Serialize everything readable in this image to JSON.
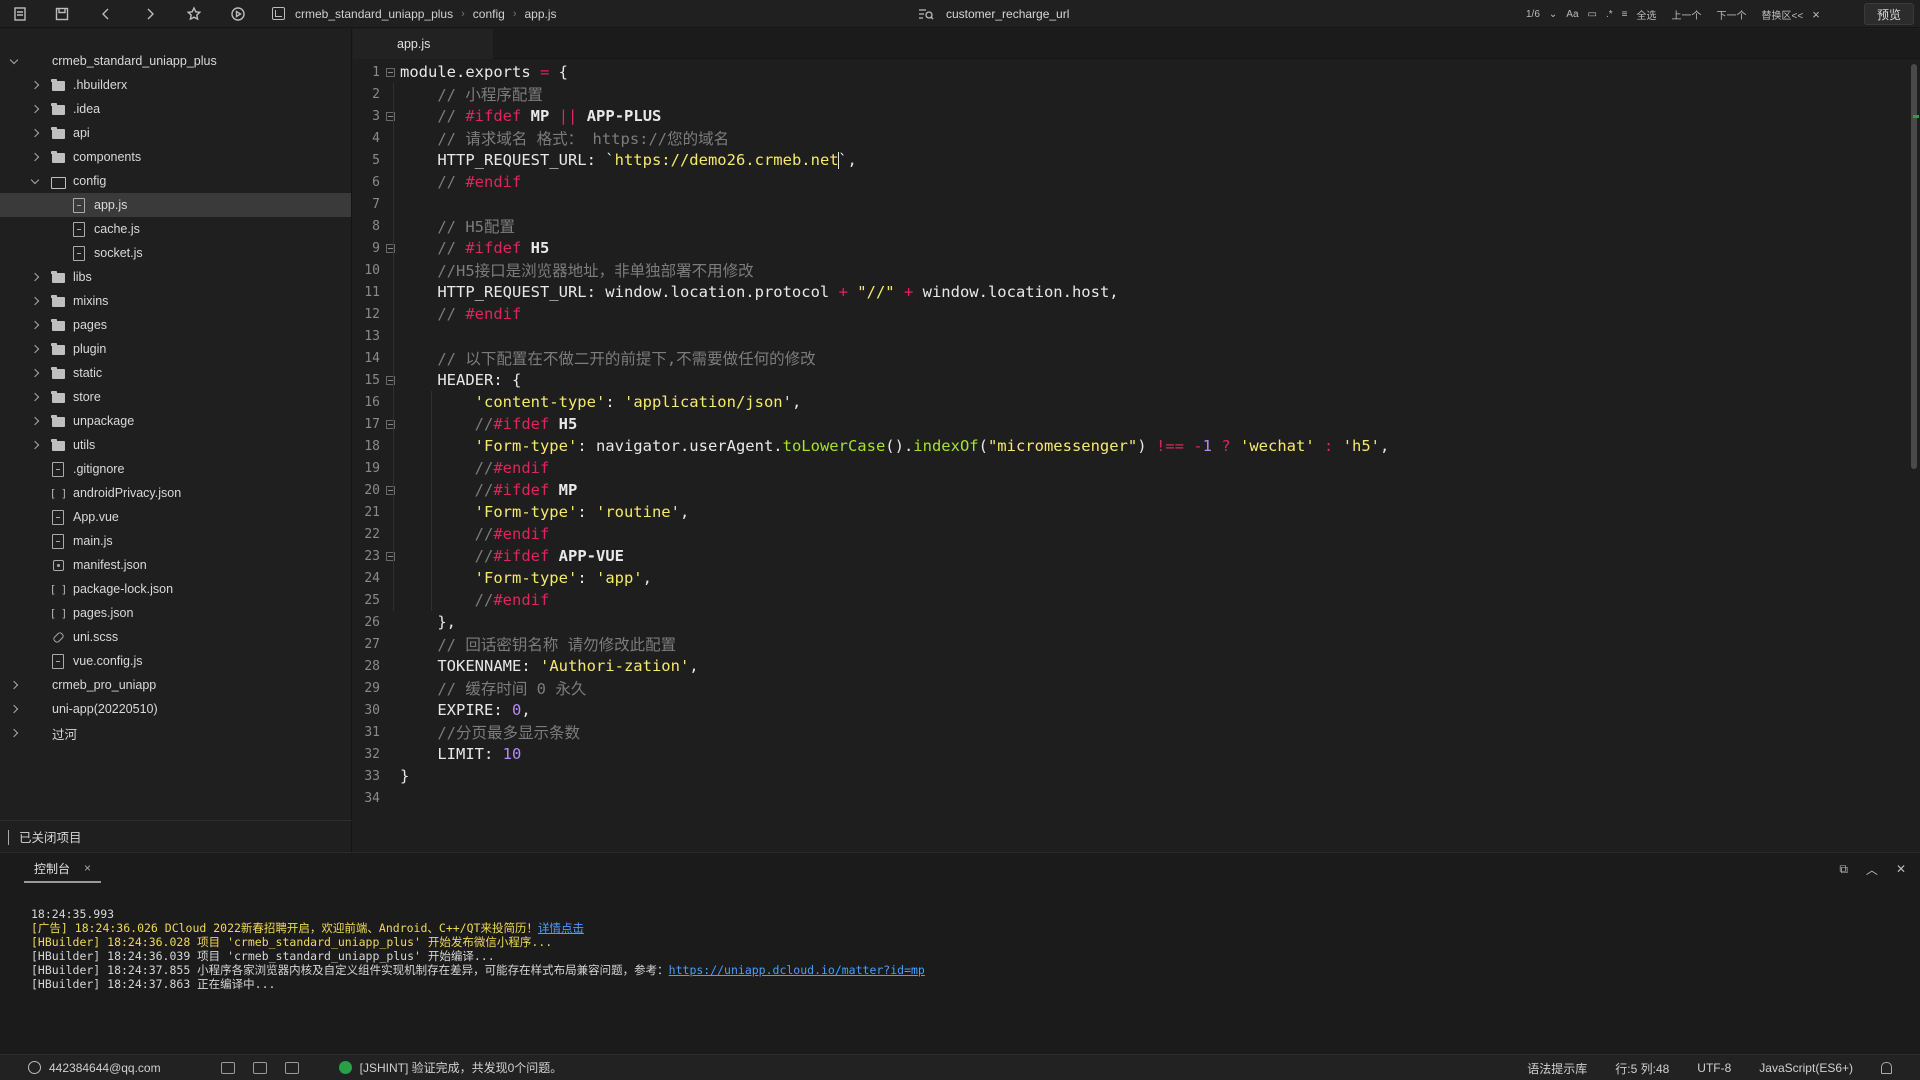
{
  "toolbar": {
    "breadcrumb": [
      "crmeb_standard_uniapp_plus",
      "config",
      "app.js"
    ],
    "search_text": "customer_recharge_url",
    "find": {
      "count": "1/6",
      "case_label": "Aa",
      "select_all": "全选",
      "prev": "上一个",
      "next": "下一个",
      "replace": "替换区<<",
      "close": "×"
    },
    "preview_label": "预览"
  },
  "sidebar": {
    "tree": [
      {
        "label": "crmeb_standard_uniapp_plus",
        "depth": 0,
        "type": "project",
        "expand": "open"
      },
      {
        "label": ".hbuilderx",
        "depth": 1,
        "type": "folder",
        "expand": "closed"
      },
      {
        "label": ".idea",
        "depth": 1,
        "type": "folder",
        "expand": "closed"
      },
      {
        "label": "api",
        "depth": 1,
        "type": "folder",
        "expand": "closed"
      },
      {
        "label": "components",
        "depth": 1,
        "type": "folder",
        "expand": "closed"
      },
      {
        "label": "config",
        "depth": 1,
        "type": "folder-open",
        "expand": "open"
      },
      {
        "label": "app.js",
        "depth": 2,
        "type": "file",
        "expand": "none",
        "selected": true
      },
      {
        "label": "cache.js",
        "depth": 2,
        "type": "file",
        "expand": "none"
      },
      {
        "label": "socket.js",
        "depth": 2,
        "type": "file",
        "expand": "none"
      },
      {
        "label": "libs",
        "depth": 1,
        "type": "folder",
        "expand": "closed"
      },
      {
        "label": "mixins",
        "depth": 1,
        "type": "folder",
        "expand": "closed"
      },
      {
        "label": "pages",
        "depth": 1,
        "type": "folder",
        "expand": "closed"
      },
      {
        "label": "plugin",
        "depth": 1,
        "type": "folder",
        "expand": "closed"
      },
      {
        "label": "static",
        "depth": 1,
        "type": "folder",
        "expand": "closed"
      },
      {
        "label": "store",
        "depth": 1,
        "type": "folder",
        "expand": "closed"
      },
      {
        "label": "unpackage",
        "depth": 1,
        "type": "folder",
        "expand": "closed"
      },
      {
        "label": "utils",
        "depth": 1,
        "type": "folder",
        "expand": "closed"
      },
      {
        "label": ".gitignore",
        "depth": 1,
        "type": "file",
        "expand": "none"
      },
      {
        "label": "androidPrivacy.json",
        "depth": 1,
        "type": "json",
        "expand": "none"
      },
      {
        "label": "App.vue",
        "depth": 1,
        "type": "file",
        "expand": "none"
      },
      {
        "label": "main.js",
        "depth": 1,
        "type": "file",
        "expand": "none"
      },
      {
        "label": "manifest.json",
        "depth": 1,
        "type": "gear",
        "expand": "none"
      },
      {
        "label": "package-lock.json",
        "depth": 1,
        "type": "json",
        "expand": "none"
      },
      {
        "label": "pages.json",
        "depth": 1,
        "type": "json",
        "expand": "none"
      },
      {
        "label": "uni.scss",
        "depth": 1,
        "type": "link",
        "expand": "none"
      },
      {
        "label": "vue.config.js",
        "depth": 1,
        "type": "file",
        "expand": "none"
      },
      {
        "label": "crmeb_pro_uniapp",
        "depth": 0,
        "type": "project",
        "expand": "closed"
      },
      {
        "label": "uni-app(20220510)",
        "depth": 0,
        "type": "project",
        "expand": "closed"
      },
      {
        "label": "过河",
        "depth": 0,
        "type": "project",
        "expand": "closed"
      }
    ],
    "closed_projects": "已关闭项目"
  },
  "editor": {
    "tab": "app.js",
    "lines": [
      {
        "n": "1",
        "fold": "box",
        "tokens": [
          [
            "code",
            "module.exports "
          ],
          [
            "k-op",
            "="
          ],
          [
            "code",
            " {"
          ]
        ]
      },
      {
        "n": "2",
        "fold": "line",
        "tokens": [
          [
            "code",
            "    "
          ],
          [
            "k-com",
            "// 小程序配置"
          ]
        ]
      },
      {
        "n": "3",
        "fold": "box",
        "tokens": [
          [
            "code",
            "    "
          ],
          [
            "k-com",
            "// "
          ],
          [
            "k-dir",
            "#ifdef"
          ],
          [
            "code",
            " "
          ],
          [
            "k-key",
            "MP"
          ],
          [
            "code",
            " "
          ],
          [
            "k-op",
            "||"
          ],
          [
            "code",
            " "
          ],
          [
            "k-key",
            "APP-PLUS"
          ]
        ]
      },
      {
        "n": "4",
        "fold": "line",
        "tokens": [
          [
            "code",
            "    "
          ],
          [
            "k-com",
            "// 请求域名 格式： https://您的域名"
          ]
        ]
      },
      {
        "n": "5",
        "fold": "line",
        "tokens": [
          [
            "code",
            "    HTTP_REQUEST_URL: `"
          ],
          [
            "k-str",
            "https://demo26.crmeb.net"
          ],
          [
            "cursor",
            ""
          ],
          [
            "code",
            "`,"
          ]
        ]
      },
      {
        "n": "6",
        "fold": "line",
        "tokens": [
          [
            "code",
            "    "
          ],
          [
            "k-com",
            "// "
          ],
          [
            "k-dir",
            "#endif"
          ]
        ]
      },
      {
        "n": "7",
        "fold": "line",
        "tokens": []
      },
      {
        "n": "8",
        "fold": "line",
        "tokens": [
          [
            "code",
            "    "
          ],
          [
            "k-com",
            "// H5配置"
          ]
        ]
      },
      {
        "n": "9",
        "fold": "box",
        "tokens": [
          [
            "code",
            "    "
          ],
          [
            "k-com",
            "// "
          ],
          [
            "k-dir",
            "#ifdef"
          ],
          [
            "code",
            " "
          ],
          [
            "k-key",
            "H5"
          ]
        ]
      },
      {
        "n": "10",
        "fold": "line",
        "tokens": [
          [
            "code",
            "    "
          ],
          [
            "k-com",
            "//H5接口是浏览器地址，非单独部署不用修改"
          ]
        ]
      },
      {
        "n": "11",
        "fold": "line",
        "tokens": [
          [
            "code",
            "    HTTP_REQUEST_URL: window.location.protocol "
          ],
          [
            "k-op",
            "+"
          ],
          [
            "code",
            " "
          ],
          [
            "k-str",
            "\"//\""
          ],
          [
            "code",
            " "
          ],
          [
            "k-op",
            "+"
          ],
          [
            "code",
            " window.location.host,"
          ]
        ]
      },
      {
        "n": "12",
        "fold": "line",
        "tokens": [
          [
            "code",
            "    "
          ],
          [
            "k-com",
            "// "
          ],
          [
            "k-dir",
            "#endif"
          ]
        ]
      },
      {
        "n": "13",
        "fold": "line",
        "tokens": []
      },
      {
        "n": "14",
        "fold": "line",
        "tokens": [
          [
            "code",
            "    "
          ],
          [
            "k-com",
            "// 以下配置在不做二开的前提下,不需要做任何的修改"
          ]
        ]
      },
      {
        "n": "15",
        "fold": "box",
        "tokens": [
          [
            "code",
            "    HEADER: {"
          ]
        ]
      },
      {
        "n": "16",
        "fold": "line",
        "tokens": [
          [
            "code",
            "        "
          ],
          [
            "k-str",
            "'content-type'"
          ],
          [
            "code",
            ": "
          ],
          [
            "k-str",
            "'application/json'"
          ],
          [
            "code",
            ","
          ]
        ]
      },
      {
        "n": "17",
        "fold": "box",
        "tokens": [
          [
            "code",
            "        "
          ],
          [
            "k-com",
            "//"
          ],
          [
            "k-dir",
            "#ifdef"
          ],
          [
            "code",
            " "
          ],
          [
            "k-key",
            "H5"
          ]
        ]
      },
      {
        "n": "18",
        "fold": "line",
        "tokens": [
          [
            "code",
            "        "
          ],
          [
            "k-str",
            "'Form-type'"
          ],
          [
            "code",
            ": navigator.userAgent."
          ],
          [
            "k-fn",
            "toLowerCase"
          ],
          [
            "code",
            "()."
          ],
          [
            "k-fn",
            "indexOf"
          ],
          [
            "code",
            "("
          ],
          [
            "k-str",
            "\"micromessenger\""
          ],
          [
            "code",
            ") "
          ],
          [
            "k-op",
            "!=="
          ],
          [
            "code",
            " "
          ],
          [
            "k-op",
            "-"
          ],
          [
            "k-num",
            "1"
          ],
          [
            "code",
            " "
          ],
          [
            "k-op",
            "?"
          ],
          [
            "code",
            " "
          ],
          [
            "k-str",
            "'wechat'"
          ],
          [
            "code",
            " "
          ],
          [
            "k-op",
            ":"
          ],
          [
            "code",
            " "
          ],
          [
            "k-str",
            "'h5'"
          ],
          [
            "code",
            ","
          ]
        ]
      },
      {
        "n": "19",
        "fold": "line",
        "tokens": [
          [
            "code",
            "        "
          ],
          [
            "k-com",
            "//"
          ],
          [
            "k-dir",
            "#endif"
          ]
        ]
      },
      {
        "n": "20",
        "fold": "box",
        "tokens": [
          [
            "code",
            "        "
          ],
          [
            "k-com",
            "//"
          ],
          [
            "k-dir",
            "#ifdef"
          ],
          [
            "code",
            " "
          ],
          [
            "k-key",
            "MP"
          ]
        ]
      },
      {
        "n": "21",
        "fold": "line",
        "tokens": [
          [
            "code",
            "        "
          ],
          [
            "k-str",
            "'Form-type'"
          ],
          [
            "code",
            ": "
          ],
          [
            "k-str",
            "'routine'"
          ],
          [
            "code",
            ","
          ]
        ]
      },
      {
        "n": "22",
        "fold": "line",
        "tokens": [
          [
            "code",
            "        "
          ],
          [
            "k-com",
            "//"
          ],
          [
            "k-dir",
            "#endif"
          ]
        ]
      },
      {
        "n": "23",
        "fold": "box",
        "tokens": [
          [
            "code",
            "        "
          ],
          [
            "k-com",
            "//"
          ],
          [
            "k-dir",
            "#ifdef"
          ],
          [
            "code",
            " "
          ],
          [
            "k-key",
            "APP-VUE"
          ]
        ]
      },
      {
        "n": "24",
        "fold": "line",
        "tokens": [
          [
            "code",
            "        "
          ],
          [
            "k-str",
            "'Form-type'"
          ],
          [
            "code",
            ": "
          ],
          [
            "k-str",
            "'app'"
          ],
          [
            "code",
            ","
          ]
        ]
      },
      {
        "n": "25",
        "fold": "line",
        "tokens": [
          [
            "code",
            "        "
          ],
          [
            "k-com",
            "//"
          ],
          [
            "k-dir",
            "#endif"
          ]
        ]
      },
      {
        "n": "26",
        "fold": "line",
        "tokens": [
          [
            "code",
            "    },"
          ]
        ]
      },
      {
        "n": "27",
        "fold": "line",
        "tokens": [
          [
            "code",
            "    "
          ],
          [
            "k-com",
            "// 回话密钥名称 请勿修改此配置"
          ]
        ]
      },
      {
        "n": "28",
        "fold": "line",
        "tokens": [
          [
            "code",
            "    TOKENNAME: "
          ],
          [
            "k-str",
            "'Authori-zation'"
          ],
          [
            "code",
            ","
          ]
        ]
      },
      {
        "n": "29",
        "fold": "line",
        "tokens": [
          [
            "code",
            "    "
          ],
          [
            "k-com",
            "// 缓存时间 0 永久"
          ]
        ]
      },
      {
        "n": "30",
        "fold": "line",
        "tokens": [
          [
            "code",
            "    EXPIRE: "
          ],
          [
            "k-num",
            "0"
          ],
          [
            "code",
            ","
          ]
        ]
      },
      {
        "n": "31",
        "fold": "line",
        "tokens": [
          [
            "code",
            "    "
          ],
          [
            "k-com",
            "//分页最多显示条数"
          ]
        ]
      },
      {
        "n": "32",
        "fold": "line",
        "tokens": [
          [
            "code",
            "    LIMIT: "
          ],
          [
            "k-num",
            "10"
          ]
        ]
      },
      {
        "n": "33",
        "fold": "none",
        "tokens": [
          [
            "code",
            "}"
          ]
        ]
      },
      {
        "n": "34",
        "fold": "none",
        "tokens": []
      }
    ]
  },
  "console": {
    "tab": "控制台",
    "close": "×",
    "logs": [
      [
        [
          "log-plain",
          "18:24:35.993"
        ]
      ],
      [
        [
          "log-yellow",
          "[广告] 18:24:36.026 DCloud 2022新春招聘开启，欢迎前端、Android、C++/QT来投简历！"
        ],
        [
          "log-link",
          "详情点击"
        ]
      ],
      [
        [
          "log-yellow",
          "[HBuilder] 18:24:36.028 项目 'crmeb_standard_uniapp_plus' 开始发布微信小程序..."
        ]
      ],
      [
        [
          "log-plain",
          "[HBuilder] 18:24:36.039 项目 'crmeb_standard_uniapp_plus' 开始编译..."
        ]
      ],
      [
        [
          "log-plain",
          "[HBuilder] 18:24:37.855 小程序各家浏览器内核及自定义组件实现机制存在差异，可能存在样式布局兼容问题，参考："
        ],
        [
          "log-link",
          "https://uniapp.dcloud.io/matter?id=mp"
        ]
      ],
      [
        [
          "log-plain",
          "[HBuilder] 18:24:37.863 正在编译中..."
        ]
      ]
    ]
  },
  "statusbar": {
    "user": "442384644@qq.com",
    "jshint": "[JSHINT] 验证完成，共发现0个问题。",
    "syntax_lib": "语法提示库",
    "position": "行:5  列:48",
    "encoding": "UTF-8",
    "language": "JavaScript(ES6+)"
  }
}
